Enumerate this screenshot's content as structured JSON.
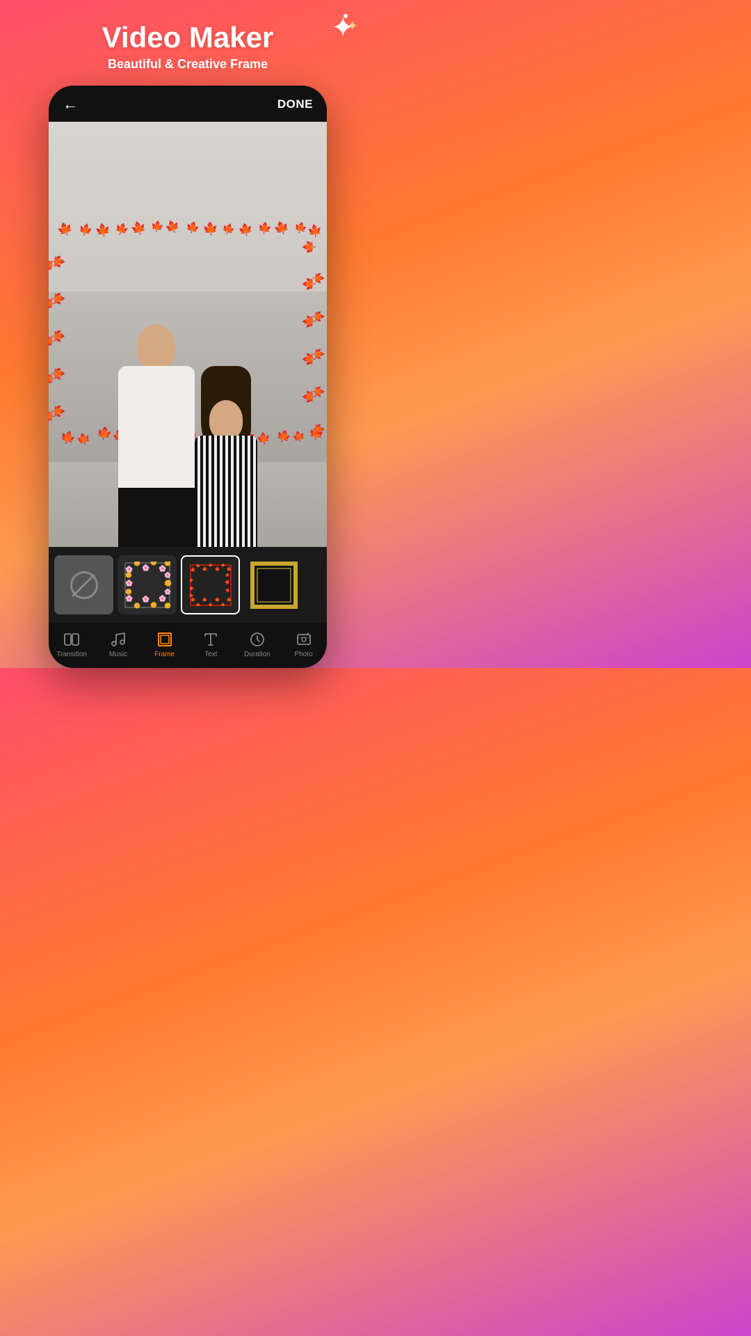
{
  "app": {
    "title": "Video Maker",
    "subtitle": "Beautiful & Creative Frame"
  },
  "header": {
    "back_label": "←",
    "done_label": "DONE"
  },
  "frames": [
    {
      "id": "none",
      "label": "None",
      "type": "none"
    },
    {
      "id": "floral",
      "label": "Floral",
      "type": "floral"
    },
    {
      "id": "leaf",
      "label": "Leaf",
      "type": "leaf",
      "selected": true
    },
    {
      "id": "gold",
      "label": "Gold",
      "type": "gold"
    }
  ],
  "bottom_nav": [
    {
      "id": "transition",
      "label": "Transition",
      "icon": "transition",
      "active": false
    },
    {
      "id": "music",
      "label": "Music",
      "icon": "music",
      "active": false
    },
    {
      "id": "frame",
      "label": "Frame",
      "icon": "frame",
      "active": true
    },
    {
      "id": "text",
      "label": "Text",
      "icon": "text",
      "active": false
    },
    {
      "id": "duration",
      "label": "Duration",
      "icon": "clock",
      "active": false
    },
    {
      "id": "photo",
      "label": "Photo",
      "icon": "photo",
      "active": false
    }
  ],
  "sparkle": {
    "big": "✦",
    "small": "✦"
  },
  "leaves": {
    "colors": [
      "#cc2200",
      "#ff4400",
      "#ff8800",
      "#ffaa00"
    ],
    "emoji": "🍁"
  }
}
